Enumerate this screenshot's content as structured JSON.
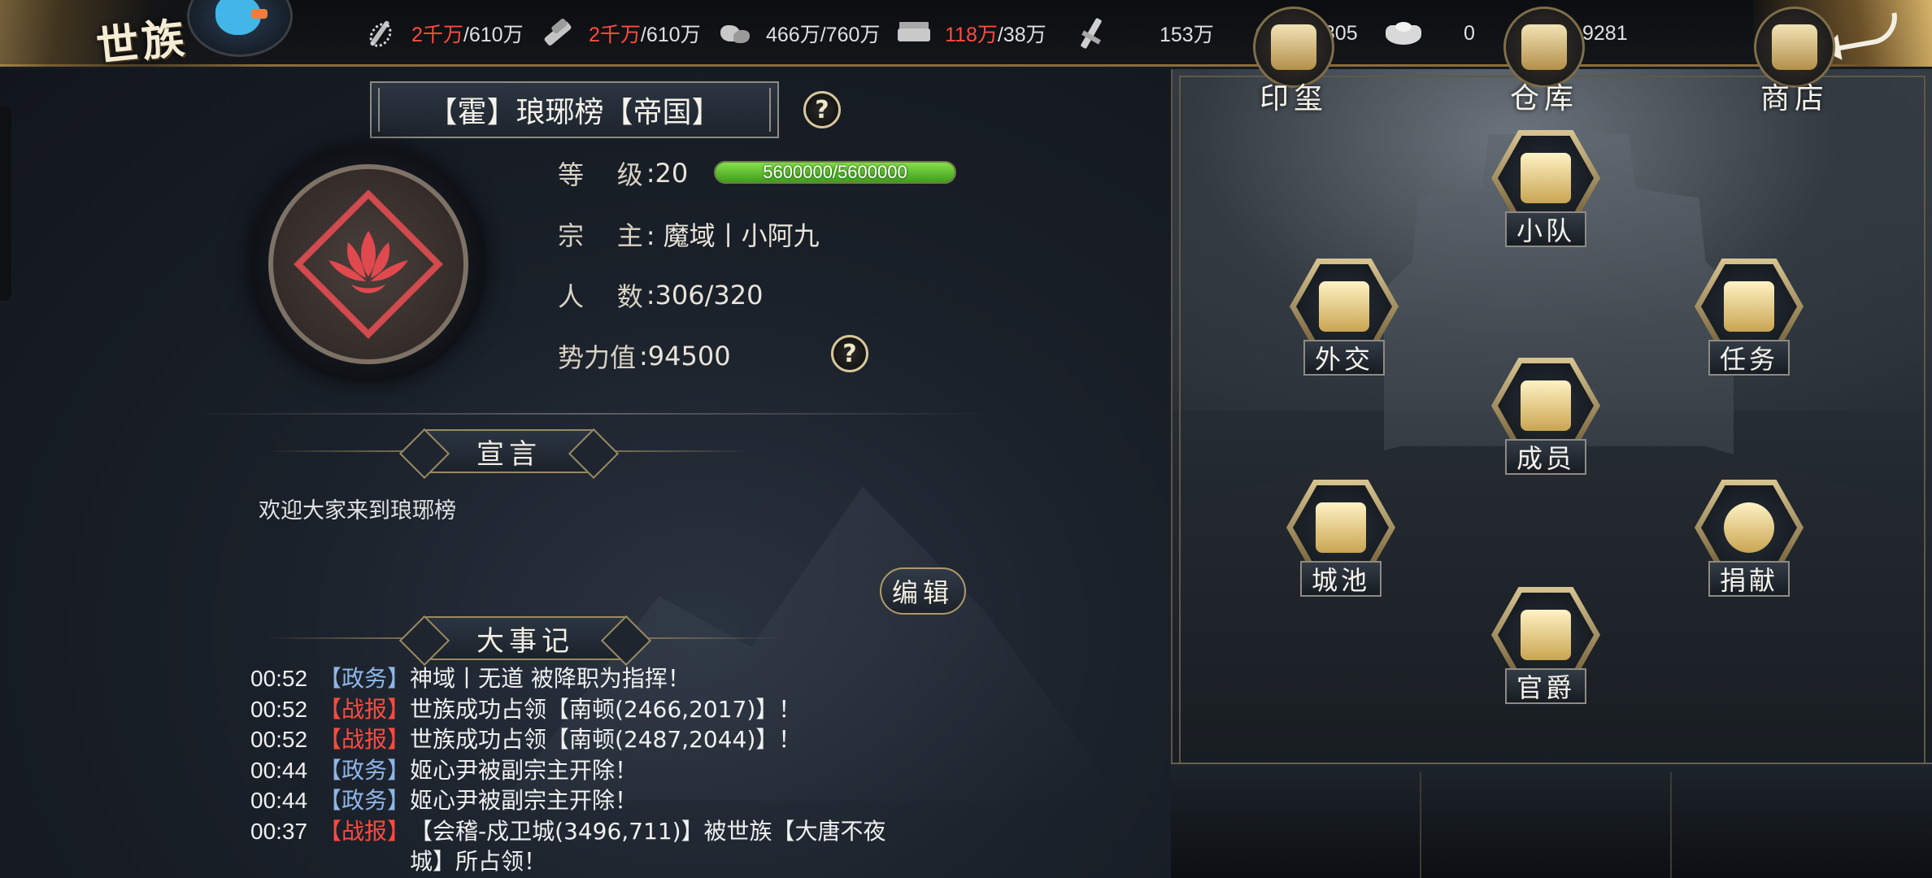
{
  "header": {
    "title": "世族",
    "resources": [
      {
        "name": "grain-icon",
        "current": "2千万",
        "max": "/610万",
        "overflow": true
      },
      {
        "name": "wood-icon",
        "current": "2千万",
        "max": "/610万",
        "overflow": true
      },
      {
        "name": "stone-icon",
        "current": "466万",
        "max": "/760万",
        "overflow": false
      },
      {
        "name": "iron-icon",
        "current": "118万",
        "max": "/38万",
        "overflow": true
      },
      {
        "name": "weapon-icon",
        "value": "153万"
      },
      {
        "name": "coin-icon",
        "value": "1305"
      },
      {
        "name": "gold-ingot-icon",
        "value": "0"
      },
      {
        "name": "silver-ingot-icon",
        "value": "9281"
      }
    ]
  },
  "guild": {
    "name": "【霍】琅琊榜【帝国】",
    "level_label": "等    级",
    "level_value": ":20",
    "exp_text": "5600000/5600000",
    "exp_progress": 1.0,
    "leader_label": "宗    主",
    "leader_value": ": 魔域丨小阿九",
    "members_label": "人    数",
    "members_value": ":306/320",
    "power_label": "势力值",
    "power_value": ":94500"
  },
  "declaration": {
    "title": "宣言",
    "text": "欢迎大家来到琅琊榜",
    "edit_label": "编辑"
  },
  "events": {
    "title": "大事记",
    "items": [
      {
        "time": "00:52",
        "tag": "【政务】",
        "type": "gov",
        "message": "神域丨无道 被降职为指挥！"
      },
      {
        "time": "00:52",
        "tag": "【战报】",
        "type": "war",
        "message": "世族成功占领【南顿(2466,2017)】！"
      },
      {
        "time": "00:52",
        "tag": "【战报】",
        "type": "war",
        "message": "世族成功占领【南顿(2487,2044)】！"
      },
      {
        "time": "00:44",
        "tag": "【政务】",
        "type": "gov",
        "message": "姬心尹被副宗主开除！"
      },
      {
        "time": "00:44",
        "tag": "【政务】",
        "type": "gov",
        "message": "姬心尹被副宗主开除！"
      },
      {
        "time": "00:37",
        "tag": "【战报】",
        "type": "war",
        "message": "【会稽-戍卫城(3496,711)】被世族【大唐不夜城】所占领！"
      }
    ]
  },
  "functions": {
    "squad": "小队",
    "diplomacy": "外交",
    "quest": "任务",
    "members": "成员",
    "cities": "城池",
    "donate": "捐献",
    "rank": "官爵"
  },
  "bottom": {
    "seal": "印玺",
    "warehouse": "仓库",
    "shop": "商店"
  },
  "colors": {
    "accent_gold": "#b09a6a",
    "warning_red": "#ff4b3d",
    "gov_blue": "#8fb6e8",
    "exp_green": "#5cc32e"
  }
}
